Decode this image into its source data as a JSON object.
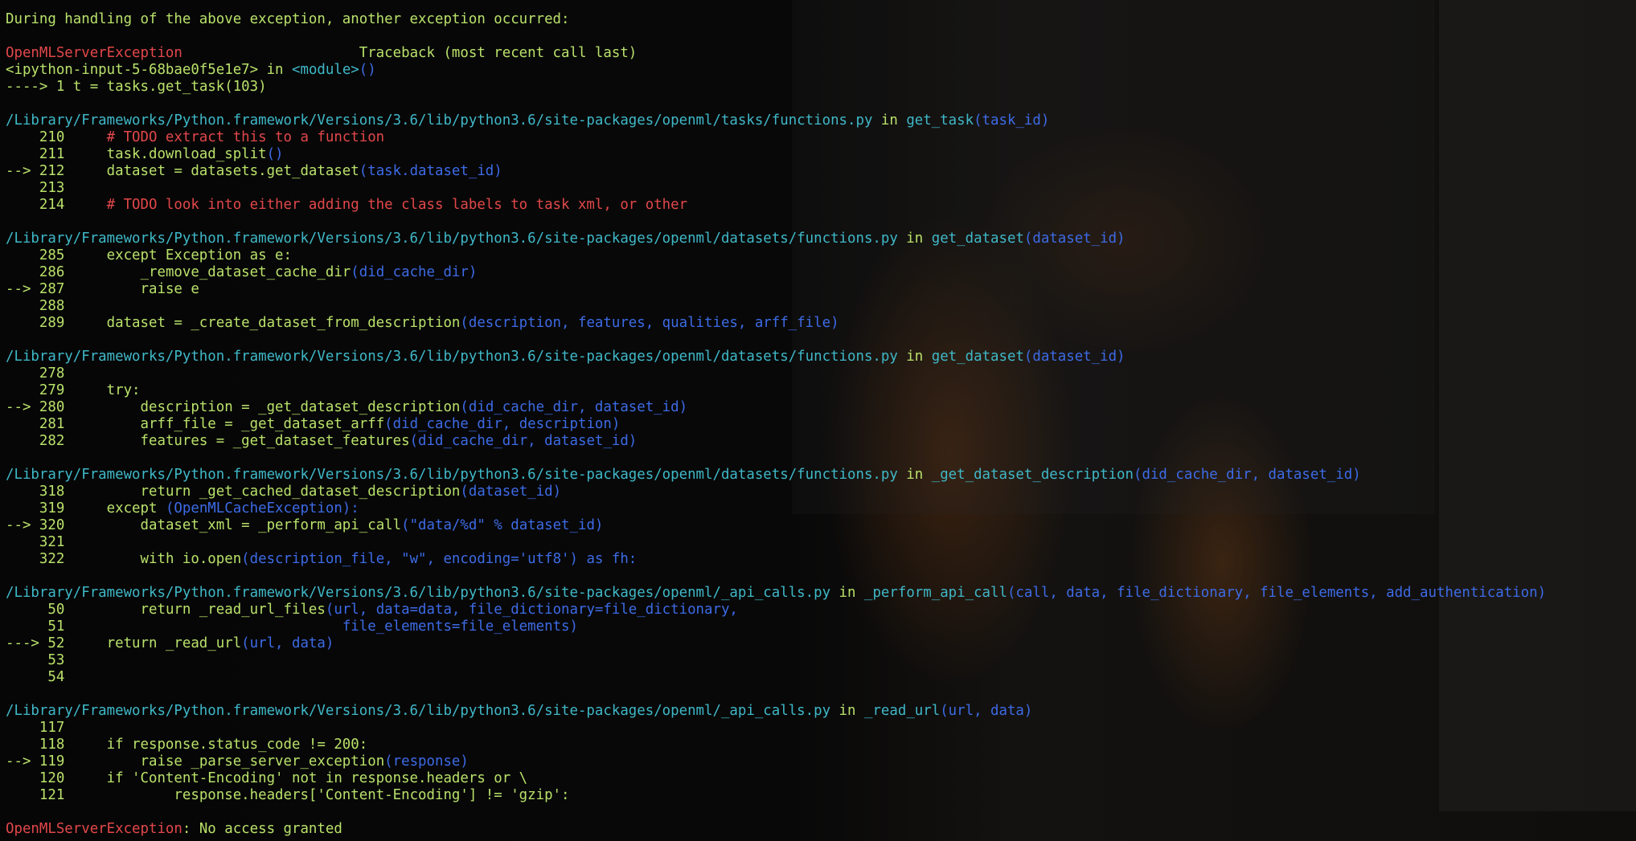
{
  "lines": [
    [
      {
        "t": "During handling of the above exception, another exception occurred:",
        "c": "g"
      }
    ],
    [],
    [
      {
        "t": "OpenMLServerException",
        "c": "r"
      },
      {
        "t": "                     Traceback (most recent call last)",
        "c": "g"
      }
    ],
    [
      {
        "t": "<ipython-input-5-68bae0f5e1e7>",
        "c": "g"
      },
      {
        "t": " in ",
        "c": "g"
      },
      {
        "t": "<module>",
        "c": "c"
      },
      {
        "t": "()",
        "c": "b"
      }
    ],
    [
      {
        "t": "----> 1 ",
        "c": "g"
      },
      {
        "t": "t = tasks.get_task(103)",
        "c": "g"
      }
    ],
    [],
    [
      {
        "t": "/Library/Frameworks/Python.framework/Versions/3.6/lib/python3.6/site-packages/openml/tasks/functions.py",
        "c": "c"
      },
      {
        "t": " in ",
        "c": "g"
      },
      {
        "t": "get_task",
        "c": "c"
      },
      {
        "t": "(task_id)",
        "c": "b"
      }
    ],
    [
      {
        "t": "    210     ",
        "c": "g"
      },
      {
        "t": "# TODO extract this to a function",
        "c": "r"
      }
    ],
    [
      {
        "t": "    211     ",
        "c": "g"
      },
      {
        "t": "task.download_split",
        "c": "g"
      },
      {
        "t": "()",
        "c": "b"
      }
    ],
    [
      {
        "t": "--> 212     ",
        "c": "g"
      },
      {
        "t": "dataset = datasets.get_dataset",
        "c": "g"
      },
      {
        "t": "(task.dataset_id)",
        "c": "b"
      }
    ],
    [
      {
        "t": "    213",
        "c": "g"
      }
    ],
    [
      {
        "t": "    214     ",
        "c": "g"
      },
      {
        "t": "# TODO look into either adding the class labels to task xml, or other",
        "c": "r"
      }
    ],
    [],
    [
      {
        "t": "/Library/Frameworks/Python.framework/Versions/3.6/lib/python3.6/site-packages/openml/datasets/functions.py",
        "c": "c"
      },
      {
        "t": " in ",
        "c": "g"
      },
      {
        "t": "get_dataset",
        "c": "c"
      },
      {
        "t": "(dataset_id)",
        "c": "b"
      }
    ],
    [
      {
        "t": "    285     ",
        "c": "g"
      },
      {
        "t": "except Exception as e:",
        "c": "g"
      }
    ],
    [
      {
        "t": "    286         ",
        "c": "g"
      },
      {
        "t": "_remove_dataset_cache_dir",
        "c": "g"
      },
      {
        "t": "(did_cache_dir)",
        "c": "b"
      }
    ],
    [
      {
        "t": "--> 287         ",
        "c": "g"
      },
      {
        "t": "raise e",
        "c": "g"
      }
    ],
    [
      {
        "t": "    288",
        "c": "g"
      }
    ],
    [
      {
        "t": "    289     ",
        "c": "g"
      },
      {
        "t": "dataset = _create_dataset_from_description",
        "c": "g"
      },
      {
        "t": "(description, features, qualities, arff_file)",
        "c": "b"
      }
    ],
    [],
    [
      {
        "t": "/Library/Frameworks/Python.framework/Versions/3.6/lib/python3.6/site-packages/openml/datasets/functions.py",
        "c": "c"
      },
      {
        "t": " in ",
        "c": "g"
      },
      {
        "t": "get_dataset",
        "c": "c"
      },
      {
        "t": "(dataset_id)",
        "c": "b"
      }
    ],
    [
      {
        "t": "    278",
        "c": "g"
      }
    ],
    [
      {
        "t": "    279     ",
        "c": "g"
      },
      {
        "t": "try:",
        "c": "g"
      }
    ],
    [
      {
        "t": "--> 280         ",
        "c": "g"
      },
      {
        "t": "description = _get_dataset_description",
        "c": "g"
      },
      {
        "t": "(did_cache_dir, dataset_id)",
        "c": "b"
      }
    ],
    [
      {
        "t": "    281         ",
        "c": "g"
      },
      {
        "t": "arff_file = _get_dataset_arff",
        "c": "g"
      },
      {
        "t": "(did_cache_dir, description)",
        "c": "b"
      }
    ],
    [
      {
        "t": "    282         ",
        "c": "g"
      },
      {
        "t": "features = _get_dataset_features",
        "c": "g"
      },
      {
        "t": "(did_cache_dir, dataset_id)",
        "c": "b"
      }
    ],
    [],
    [
      {
        "t": "/Library/Frameworks/Python.framework/Versions/3.6/lib/python3.6/site-packages/openml/datasets/functions.py",
        "c": "c"
      },
      {
        "t": " in ",
        "c": "g"
      },
      {
        "t": "_get_dataset_description",
        "c": "c"
      },
      {
        "t": "(did_cache_dir, dataset_id)",
        "c": "b"
      }
    ],
    [
      {
        "t": "    318         ",
        "c": "g"
      },
      {
        "t": "return _get_cached_dataset_description",
        "c": "g"
      },
      {
        "t": "(dataset_id)",
        "c": "b"
      }
    ],
    [
      {
        "t": "    319     ",
        "c": "g"
      },
      {
        "t": "except ",
        "c": "g"
      },
      {
        "t": "(OpenMLCacheException):",
        "c": "b"
      }
    ],
    [
      {
        "t": "--> 320         ",
        "c": "g"
      },
      {
        "t": "dataset_xml = _perform_api_call",
        "c": "g"
      },
      {
        "t": "(\"data/%d\" % dataset_id)",
        "c": "b"
      }
    ],
    [
      {
        "t": "    321",
        "c": "g"
      }
    ],
    [
      {
        "t": "    322         ",
        "c": "g"
      },
      {
        "t": "with io.open",
        "c": "g"
      },
      {
        "t": "(description_file, \"w\", encoding='utf8') as fh:",
        "c": "b"
      }
    ],
    [],
    [
      {
        "t": "/Library/Frameworks/Python.framework/Versions/3.6/lib/python3.6/site-packages/openml/_api_calls.py",
        "c": "c"
      },
      {
        "t": " in ",
        "c": "g"
      },
      {
        "t": "_perform_api_call",
        "c": "c"
      },
      {
        "t": "(call, data, file_dictionary, file_elements, add_authentication)",
        "c": "b"
      }
    ],
    [
      {
        "t": "     50         ",
        "c": "g"
      },
      {
        "t": "return _read_url_files",
        "c": "g"
      },
      {
        "t": "(url, data=data, file_dictionary=file_dictionary,",
        "c": "b"
      }
    ],
    [
      {
        "t": "     51                                 ",
        "c": "g"
      },
      {
        "t": "file_elements=file_elements)",
        "c": "b"
      }
    ],
    [
      {
        "t": "---> 52     ",
        "c": "g"
      },
      {
        "t": "return _read_url",
        "c": "g"
      },
      {
        "t": "(url, data)",
        "c": "b"
      }
    ],
    [
      {
        "t": "     53",
        "c": "g"
      }
    ],
    [
      {
        "t": "     54",
        "c": "g"
      }
    ],
    [],
    [
      {
        "t": "/Library/Frameworks/Python.framework/Versions/3.6/lib/python3.6/site-packages/openml/_api_calls.py",
        "c": "c"
      },
      {
        "t": " in ",
        "c": "g"
      },
      {
        "t": "_read_url",
        "c": "c"
      },
      {
        "t": "(url, data)",
        "c": "b"
      }
    ],
    [
      {
        "t": "    117",
        "c": "g"
      }
    ],
    [
      {
        "t": "    118     ",
        "c": "g"
      },
      {
        "t": "if response.status_code != 200:",
        "c": "g"
      }
    ],
    [
      {
        "t": "--> 119         ",
        "c": "g"
      },
      {
        "t": "raise _parse_server_exception",
        "c": "g"
      },
      {
        "t": "(response)",
        "c": "b"
      }
    ],
    [
      {
        "t": "    120     ",
        "c": "g"
      },
      {
        "t": "if 'Content-Encoding' not in response.headers or \\",
        "c": "g"
      }
    ],
    [
      {
        "t": "    121             ",
        "c": "g"
      },
      {
        "t": "response.headers['Content-Encoding'] != 'gzip':",
        "c": "g"
      }
    ],
    [],
    [
      {
        "t": "OpenMLServerException",
        "c": "r"
      },
      {
        "t": ": No access granted",
        "c": "g"
      }
    ]
  ]
}
